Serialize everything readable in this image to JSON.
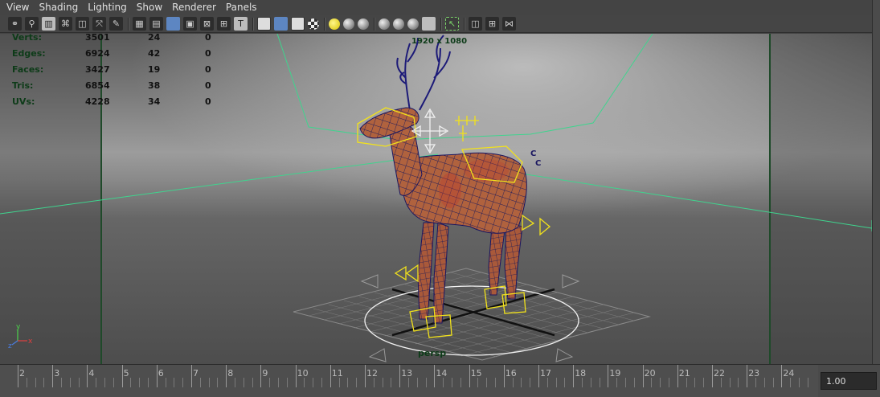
{
  "menubar": {
    "items": [
      "View",
      "Shading",
      "Lighting",
      "Show",
      "Renderer",
      "Panels"
    ]
  },
  "toolbar": {
    "icons": [
      "select-camera-icon",
      "lock-camera-icon",
      "camera-attributes-icon",
      "bookmark-icon",
      "image-plane-icon",
      "2d-pan-zoom-icon",
      "grease-pencil-icon",
      "grid-icon",
      "film-gate-icon",
      "resolution-gate-icon",
      "gate-mask-icon",
      "field-chart-icon",
      "safe-action-icon",
      "safe-title-icon",
      "wireframe-icon",
      "smooth-shade-icon",
      "wireframe-on-shaded-icon",
      "textured-icon",
      "use-all-lights-icon",
      "shadows-icon",
      "ambient-occlusion-icon",
      "isolate-select-icon",
      "xray-icon",
      "xray-joints-icon",
      "xray-components-icon",
      "highlight-selection-icon",
      "two-panel-icon",
      "four-panel-icon",
      "outliner-icon"
    ]
  },
  "hud": {
    "rows": [
      {
        "label": "Verts:",
        "v1": "3501",
        "v2": "24",
        "v3": "0"
      },
      {
        "label": "Edges:",
        "v1": "6924",
        "v2": "42",
        "v3": "0"
      },
      {
        "label": "Faces:",
        "v1": "3427",
        "v2": "19",
        "v3": "0"
      },
      {
        "label": "Tris:",
        "v1": "6854",
        "v2": "38",
        "v3": "0"
      },
      {
        "label": "UVs:",
        "v1": "4228",
        "v2": "34",
        "v3": "0"
      }
    ],
    "resolution": "1920 x 1080",
    "camera_name": "persp"
  },
  "axis_gizmo": {
    "x": "x",
    "y": "y",
    "z": "z"
  },
  "timeline": {
    "ticks": [
      "2",
      "3",
      "4",
      "5",
      "6",
      "7",
      "8",
      "9",
      "10",
      "11",
      "12",
      "13",
      "14",
      "15",
      "16",
      "17",
      "18",
      "19",
      "20",
      "21",
      "22",
      "23",
      "24"
    ],
    "current_time": "1.00"
  },
  "colors": {
    "gate_line": "#3fd48e",
    "mesh_wire": "#1a1a6e",
    "mesh_fill": "#b85f3a",
    "control_yellow": "#f2e21b",
    "hud_label": "#0d3b18"
  }
}
